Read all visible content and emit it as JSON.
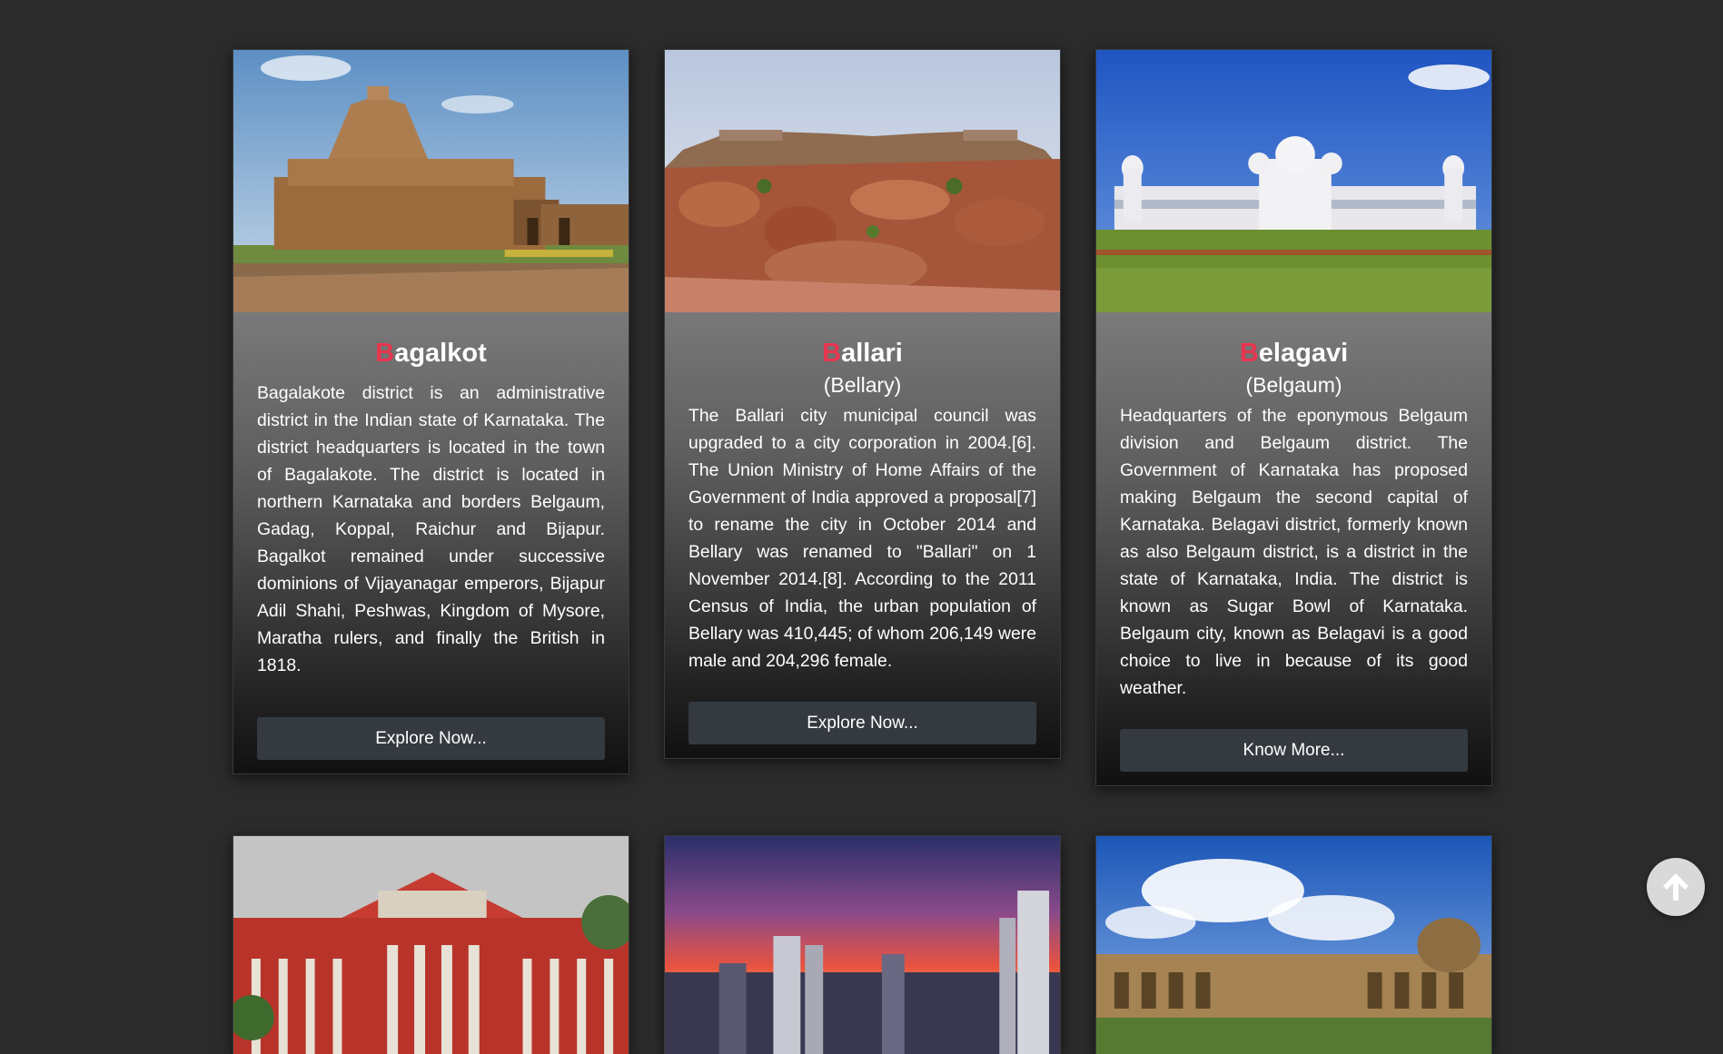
{
  "cards": [
    {
      "initial": "B",
      "name_rest": "agalkot",
      "subtitle": "",
      "description": "Bagalakote district is an administrative district in the Indian state of Karnataka. The district headquarters is located in the town of Bagalakote. The district is located in northern Karnataka and borders Belgaum, Gadag, Koppal, Raichur and Bijapur. Bagalkot remained under successive dominions of Vijayanagar emperors, Bijapur Adil Shahi, Peshwas, Kingdom of Mysore, Maratha rulers, and finally the British in 1818.",
      "button": "Explore Now..."
    },
    {
      "initial": "B",
      "name_rest": "allari",
      "subtitle": "(Bellary)",
      "description": "The Ballari city municipal council was upgraded to a city corporation in 2004.[6]. The Union Ministry of Home Affairs of the Government of India approved a proposal[7] to rename the city in October 2014 and Bellary was renamed to \"Ballari\" on 1 November 2014.[8]. According to the 2011 Census of India, the urban population of Bellary was 410,445; of whom 206,149 were male and 204,296 female.",
      "button": "Explore Now..."
    },
    {
      "initial": "B",
      "name_rest": "elagavi",
      "subtitle": "(Belgaum)",
      "description": "Headquarters of the eponymous Belgaum division and Belgaum district. The Government of Karnataka has proposed making Belgaum the second capital of Karnataka. Belagavi district, formerly known as also Belgaum district, is a district in the state of Karnataka, India. The district is known as Sugar Bowl of Karnataka. Belgaum city, known as Belagavi is a good choice to live in because of its good weather.",
      "button": "Know More..."
    }
  ],
  "scroll_top": {
    "icon": "arrow-up-icon"
  }
}
